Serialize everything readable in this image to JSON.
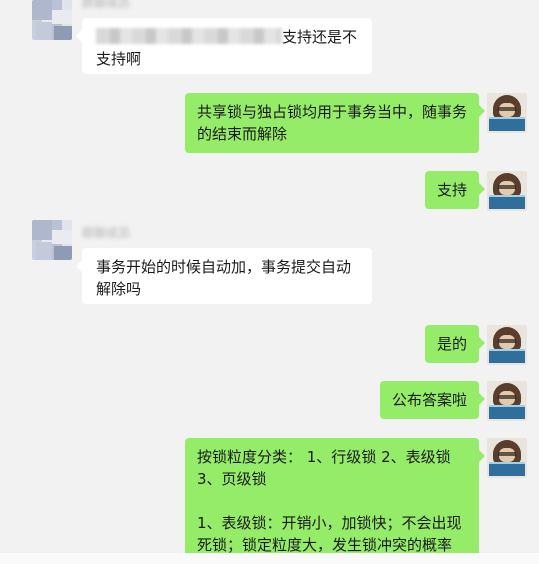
{
  "messages": [
    {
      "side": "left",
      "name": "群聊成员",
      "text_redacted_prefix": true,
      "text": "支持还是不支持啊"
    },
    {
      "side": "right",
      "text": "共享锁与独占锁均用于事务当中，随事务的结束而解除"
    },
    {
      "side": "right",
      "text": "支持"
    },
    {
      "side": "left",
      "name": "群聊成员",
      "text": "事务开始的时候自动加，事务提交自动解除吗"
    },
    {
      "side": "right",
      "text": "是的"
    },
    {
      "side": "right",
      "text": "公布答案啦"
    },
    {
      "side": "right",
      "paragraphs": [
        "按锁粒度分类： 1、行级锁  2、表级锁  3、页级锁",
        "1、表级锁：开销小，加锁快；不会出现死锁；锁定粒度大，发生锁冲突的概率"
      ]
    }
  ],
  "colors": {
    "background": "#f2f2f2",
    "bubble_self": "#95ec69",
    "bubble_other": "#ffffff",
    "text": "#1a1a1a"
  }
}
